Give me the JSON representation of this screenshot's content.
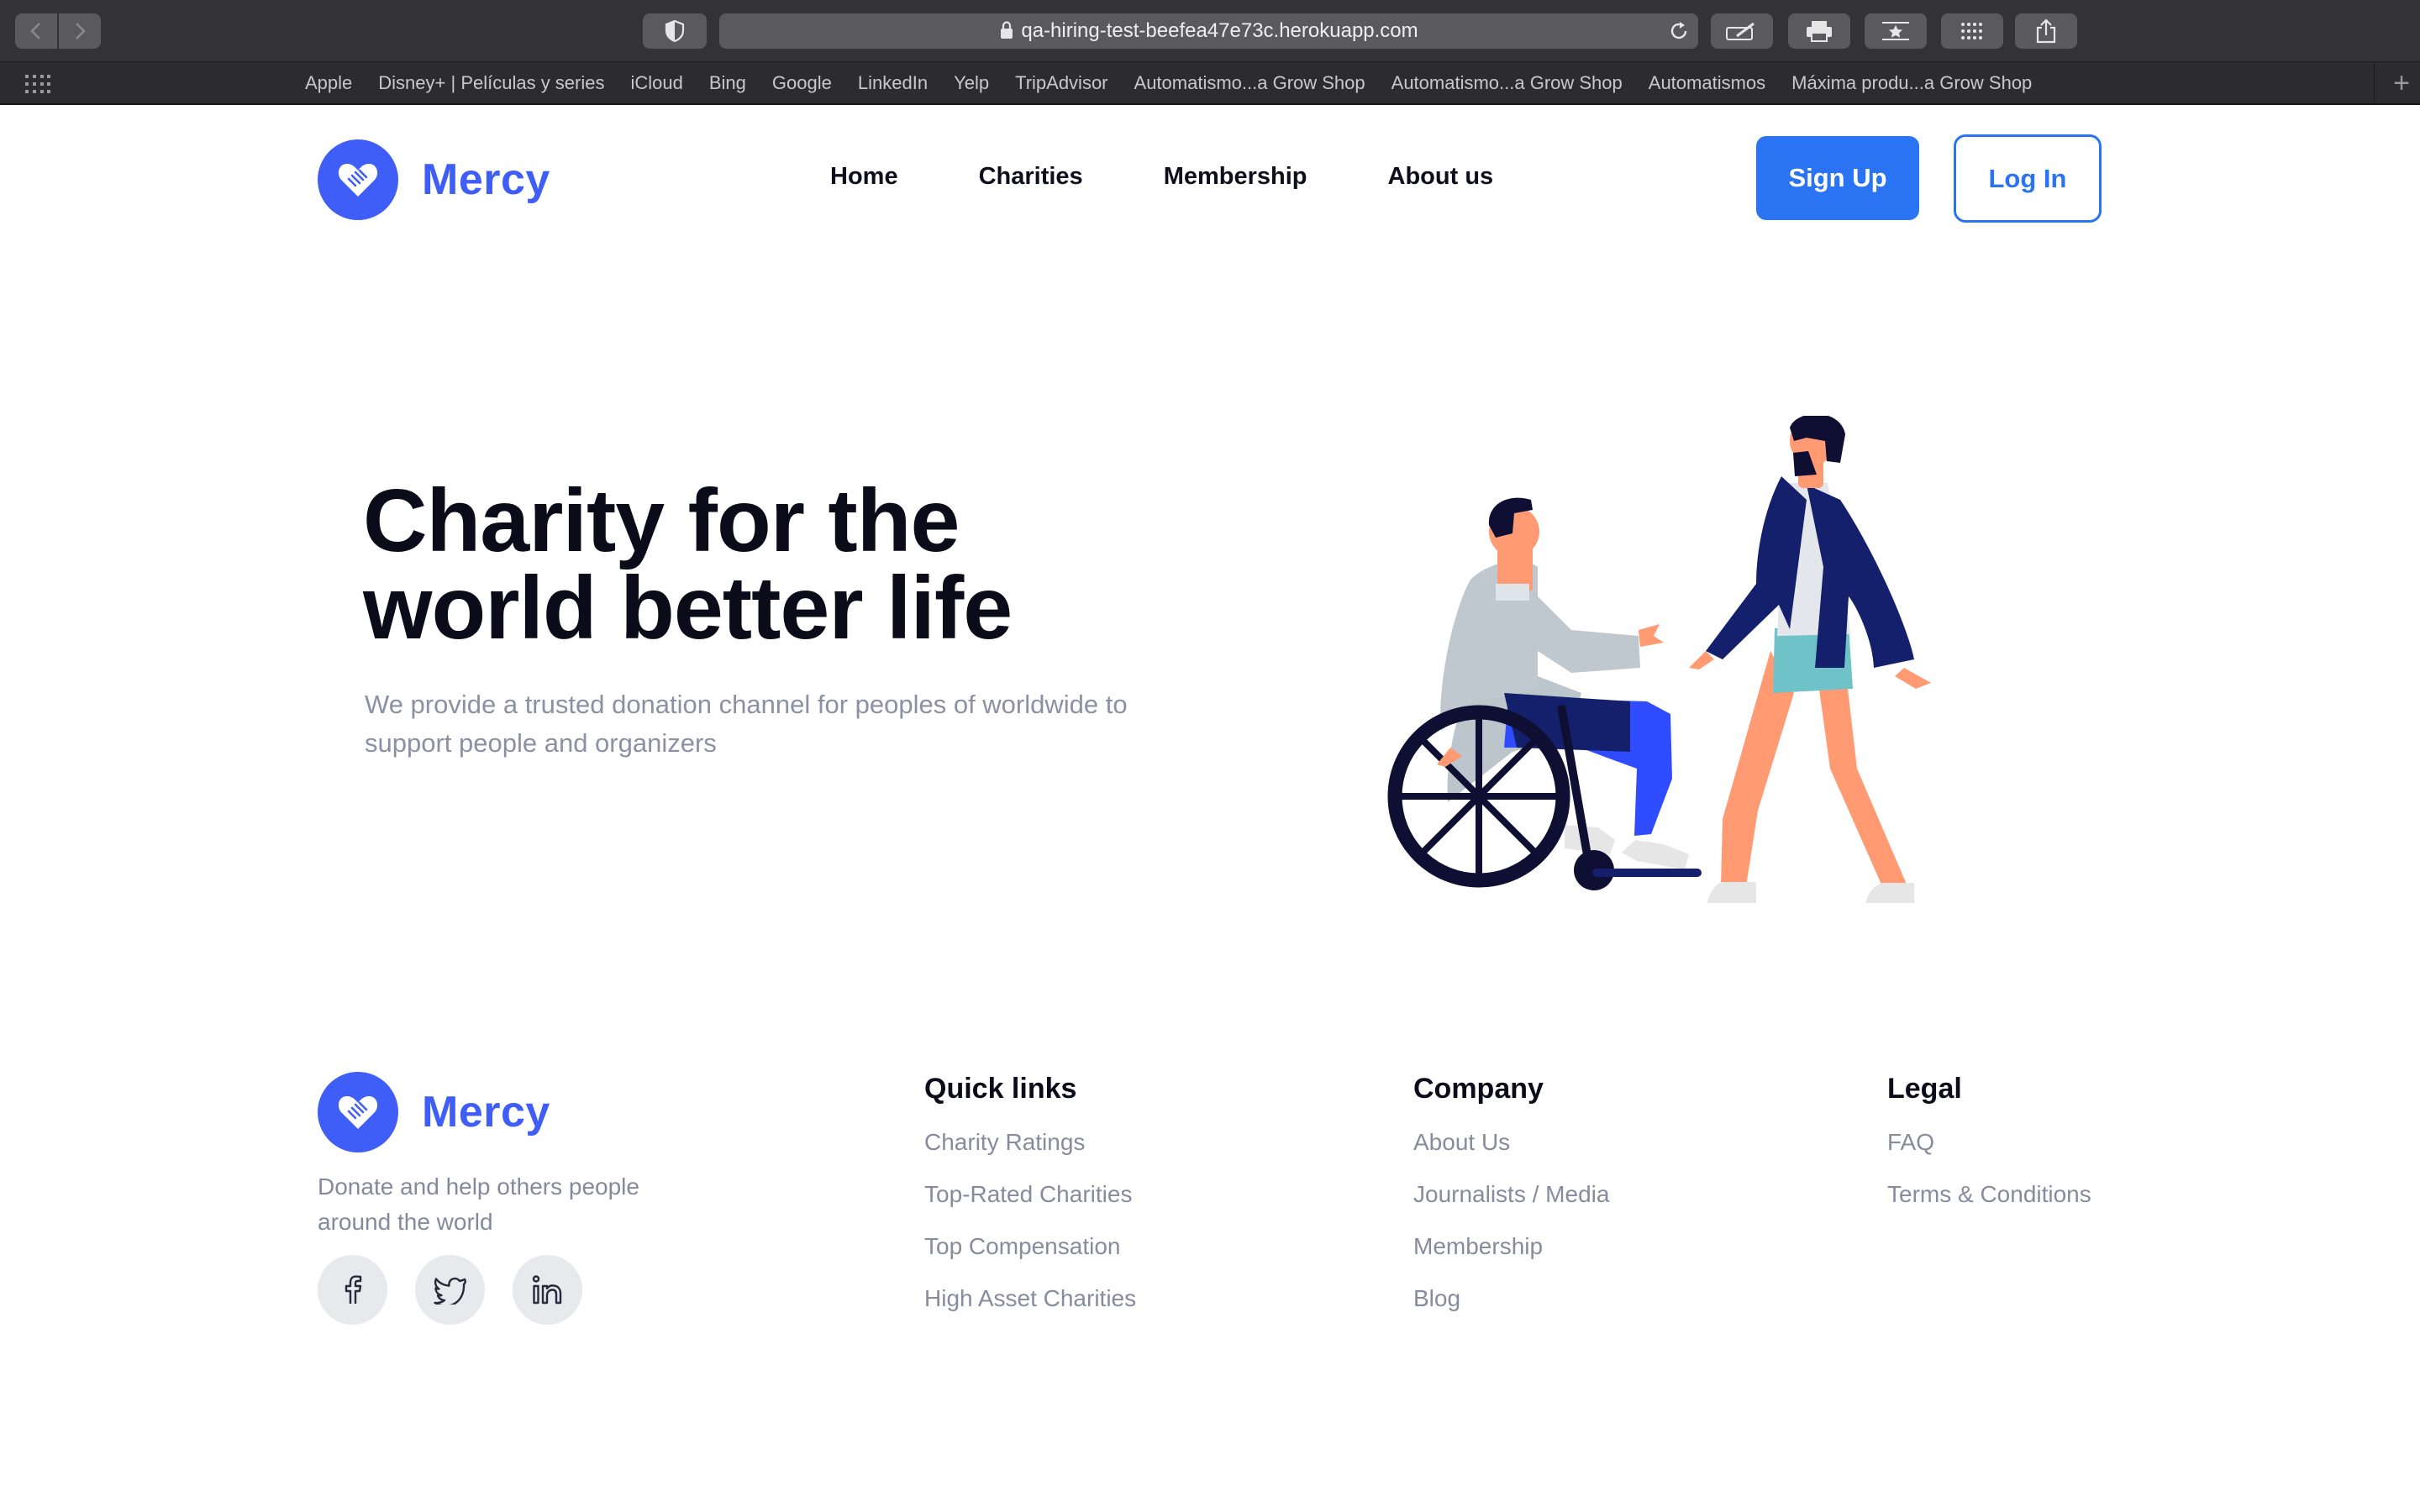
{
  "browser": {
    "url": "qa-hiring-test-beefea47e73c.herokuapp.com",
    "bookmarks": [
      "Apple",
      "Disney+ | Películas y series",
      "iCloud",
      "Bing",
      "Google",
      "LinkedIn",
      "Yelp",
      "TripAdvisor",
      "Automatismo...a Grow Shop",
      "Automatismo...a Grow Shop",
      "Automatismos",
      "Máxima produ...a Grow Shop"
    ]
  },
  "header": {
    "brand": "Mercy",
    "nav": [
      "Home",
      "Charities",
      "Membership",
      "About us"
    ],
    "signup_label": "Sign Up",
    "login_label": "Log In"
  },
  "hero": {
    "title_line1": "Charity for the",
    "title_line2": "world better life",
    "subtitle": "We provide a trusted donation channel for peoples of worldwide to support people and organizers"
  },
  "footer": {
    "brand": "Mercy",
    "tagline": "Donate and help others people around the world",
    "social": [
      "facebook-icon",
      "twitter-icon",
      "linkedin-icon"
    ],
    "quick_links": {
      "heading": "Quick links",
      "links": [
        "Charity Ratings",
        "Top-Rated Charities",
        "Top Compensation",
        "High Asset Charities"
      ]
    },
    "company": {
      "heading": "Company",
      "links": [
        "About Us",
        "Journalists / Media",
        "Membership",
        "Blog"
      ]
    },
    "legal": {
      "heading": "Legal",
      "links": [
        "FAQ",
        "Terms & Conditions"
      ]
    }
  },
  "colors": {
    "brand": "#3f5ef8",
    "primary_button": "#2a73f2",
    "heading": "#0b0b1a",
    "muted_text": "#8a91a4"
  }
}
